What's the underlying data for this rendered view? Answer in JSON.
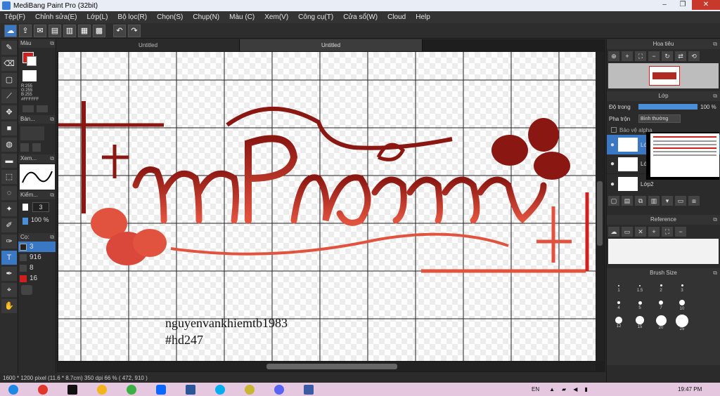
{
  "window": {
    "title": "MediBang Paint Pro (32bit)"
  },
  "menu": [
    "Tệp(F)",
    "Chỉnh sửa(E)",
    "Lớp(L)",
    "Bộ lọc(R)",
    "Chọn(S)",
    "Chụp(N)",
    "Màu (C)",
    "Xem(V)",
    "Công cụ(T)",
    "Cửa sổ(W)",
    "Cloud",
    "Help"
  ],
  "color_panel": {
    "title": "Màu",
    "r": "R:255",
    "g": "G:255",
    "b": "B:255",
    "hex": "#FFFFFF",
    "fg_color": "#d11f1f",
    "bg_color": "#ffffff"
  },
  "brush_panel": {
    "title": "Bàn..."
  },
  "navigator_small": {
    "title": "Xem..."
  },
  "check_panel": {
    "title": "Kiểm...",
    "size": "3",
    "opacity": "100 %"
  },
  "brush_list": {
    "title": "Cọ:",
    "items": [
      "3",
      "916",
      "8",
      "16"
    ]
  },
  "tabs": [
    "Untitled",
    "Untitled"
  ],
  "canvas": {
    "watermark_line1": "nguyenvankhiemtb1983",
    "watermark_line2": "#hd247",
    "art_text": "Lê Phương Anh",
    "art_color_dark": "#8b1712",
    "art_color_light": "#e2533f"
  },
  "status": "1600 * 1200 pixel   (11.6 * 8.7cm)   350 dpi   66 %   ( 472, 910 )",
  "navigator": {
    "title": "Hoa tiêu"
  },
  "layers": {
    "title": "Lớp",
    "opacity_label": "Độ trong",
    "opacity_value": "100 %",
    "opacity_fraction": 1.0,
    "blend_label": "Pha trộn",
    "blend_value": "Bình thường",
    "protect_label": "Bảo vệ alpha",
    "items": [
      {
        "name": "Lớp1",
        "visible": true
      },
      {
        "name": "Lớp3",
        "visible": true
      },
      {
        "name": "Lớp2",
        "visible": true
      }
    ]
  },
  "reference": {
    "title": "Reference"
  },
  "brush_size": {
    "title": "Brush Size",
    "sizes": [
      "1",
      "1.5",
      "2",
      "3",
      "4",
      "5",
      "7",
      "10",
      "12",
      "15",
      "20",
      "25"
    ]
  },
  "taskbar": {
    "lang": "EN",
    "time": "19:47 PM",
    "apps": [
      {
        "name": "chrome",
        "color": "#e0372a"
      },
      {
        "name": "capcut",
        "color": "#111111"
      },
      {
        "name": "chrome-2",
        "color": "#f3b51c"
      },
      {
        "name": "app-green",
        "color": "#3cb043"
      },
      {
        "name": "zalo",
        "color": "#0a68ff"
      },
      {
        "name": "word",
        "color": "#2b579a"
      },
      {
        "name": "skype",
        "color": "#00aff0"
      },
      {
        "name": "paint",
        "color": "#c8b634"
      },
      {
        "name": "discord",
        "color": "#5865f2"
      },
      {
        "name": "medibang",
        "color": "#3b5ba5"
      }
    ]
  }
}
